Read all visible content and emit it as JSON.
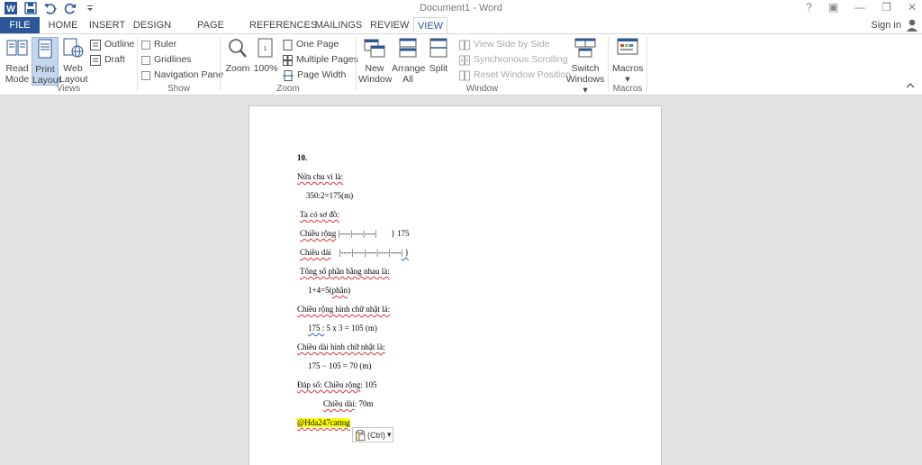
{
  "window": {
    "title": "Document1 - Word",
    "controls": [
      "?",
      "▣",
      "—",
      "❐",
      "✕"
    ]
  },
  "tabs": {
    "file": "FILE",
    "home": "HOME",
    "insert": "INSERT",
    "design": "DESIGN",
    "page_layout": "PAGE LAYOUT",
    "references": "REFERENCES",
    "mailings": "MAILINGS",
    "review": "REVIEW",
    "view": "VIEW",
    "sign_in": "Sign in"
  },
  "ribbon": {
    "views": {
      "label": "Views",
      "read_mode_1": "Read",
      "read_mode_2": "Mode",
      "print_layout_1": "Print",
      "print_layout_2": "Layout",
      "web_layout_1": "Web",
      "web_layout_2": "Layout",
      "outline": "Outline",
      "draft": "Draft"
    },
    "show": {
      "label": "Show",
      "ruler": "Ruler",
      "gridlines": "Gridlines",
      "navigation_pane": "Navigation Pane"
    },
    "zoom": {
      "label": "Zoom",
      "zoom": "Zoom",
      "hundred": "100%",
      "one_page": "One Page",
      "multiple_pages": "Multiple Pages",
      "page_width": "Page Width"
    },
    "window": {
      "label": "Window",
      "new_window_1": "New",
      "new_window_2": "Window",
      "arrange_all_1": "Arrange",
      "arrange_all_2": "All",
      "split": "Split",
      "view_side_by_side": "View Side by Side",
      "sync_scrolling": "Synchronous Scrolling",
      "reset_window_position": "Reset Window Position",
      "switch_windows_1": "Switch",
      "switch_windows_2": "Windows ▾"
    },
    "macros": {
      "label": "Macros",
      "macros": "Macros",
      "macros_arrow": "▾"
    }
  },
  "document": {
    "heading": "10.",
    "l1": "Nửa chu vi là:",
    "l2": "350:2=175(m)",
    "l3": "Ta có sơ đồ:",
    "l4a": "Chiều rộng",
    "l4b": " |----|----|----|",
    "l4c": "       } 175",
    "l5a": "Chiều dài",
    "l5b": "    |----|----|----|----|----",
    "l5c": "| }",
    "l6": "Tổng số phần bằng nhau là:",
    "l7a": "1+4=5(",
    "l7b": "phần",
    "l7c": ")",
    "l8": "Chiều rộng hình chữ nhật là:",
    "l9a": "175 :",
    "l9b": " 5 x 3 = 105 (m)",
    "l10": "Chiều dài hình chữ nhật là:",
    "l11": "175 − 105 = 70 (m)",
    "l12a": "Đáp số: Chiều rộng",
    "l12b": ": 105",
    "l13a": "Chiều dài",
    "l13b": ": 70m",
    "l14": "@Hda247cattng",
    "paste_label": "(Ctrl)",
    "paste_arrow": "▾"
  }
}
